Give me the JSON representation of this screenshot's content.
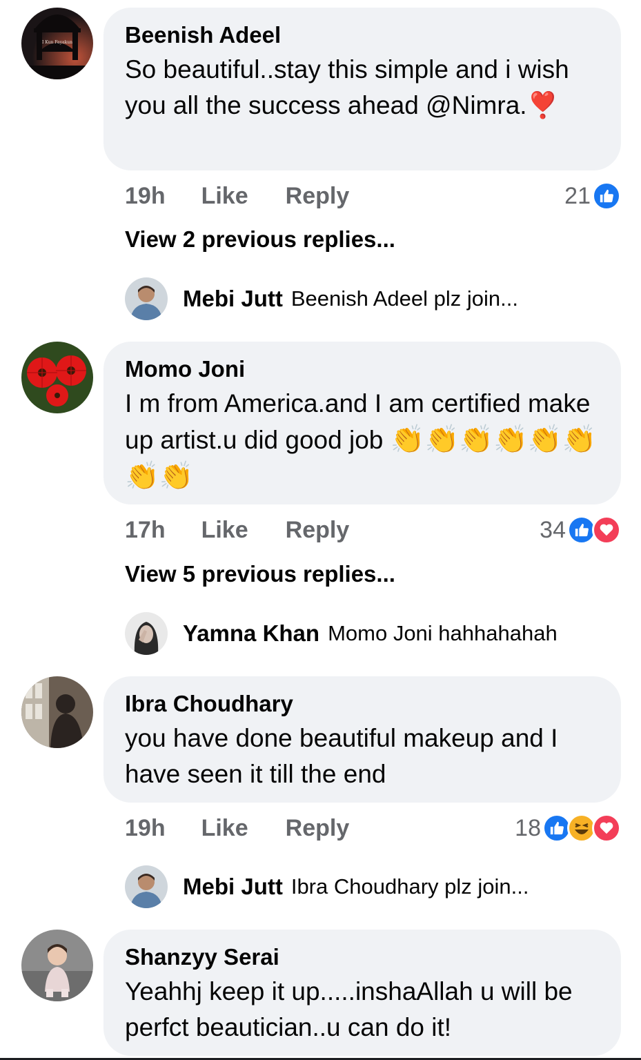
{
  "comments": [
    {
      "author": "Beenish Adeel",
      "text": "So beautiful..stay this simple and i wish you all the success ahead @Nimra.",
      "emoji": "❣️",
      "time": "19h",
      "like_label": "Like",
      "reply_label": "Reply",
      "reaction_count": "21",
      "reactions": [
        "like-icon"
      ],
      "view_more": "View 2 previous replies...",
      "reply": {
        "author": "Mebi Jutt",
        "text": "Beenish Adeel plz join..."
      }
    },
    {
      "author": "Momo Joni",
      "text": "I m from America.and I am certified make up artist.u did good job",
      "emoji": "👏👏👏👏👏👏👏👏",
      "time": "17h",
      "like_label": "Like",
      "reply_label": "Reply",
      "reaction_count": "34",
      "reactions": [
        "like-icon",
        "love-icon"
      ],
      "view_more": "View 5 previous replies...",
      "reply": {
        "author": "Yamna Khan",
        "text": "Momo Joni hahhahahah"
      }
    },
    {
      "author": "Ibra Choudhary",
      "text": "you have done beautiful makeup and I have seen it till the end",
      "time": "19h",
      "like_label": "Like",
      "reply_label": "Reply",
      "reaction_count": "18",
      "reactions": [
        "like-icon",
        "haha-icon",
        "love-icon"
      ],
      "reply": {
        "author": "Mebi Jutt",
        "text": "Ibra Choudhary plz join..."
      }
    },
    {
      "author": "Shanzyy Serai",
      "text": "Yeahhj keep it up.....inshaAllah u will be perfct beautician..u can do it!"
    }
  ],
  "avatar_caption": "I Kun Fayakun",
  "colors": {
    "bubble": "#f0f2f5",
    "like_blue": "#1877f2",
    "love_red": "#f33e58",
    "haha_yellow": "#f7b125",
    "secondary_text": "#65676b"
  }
}
